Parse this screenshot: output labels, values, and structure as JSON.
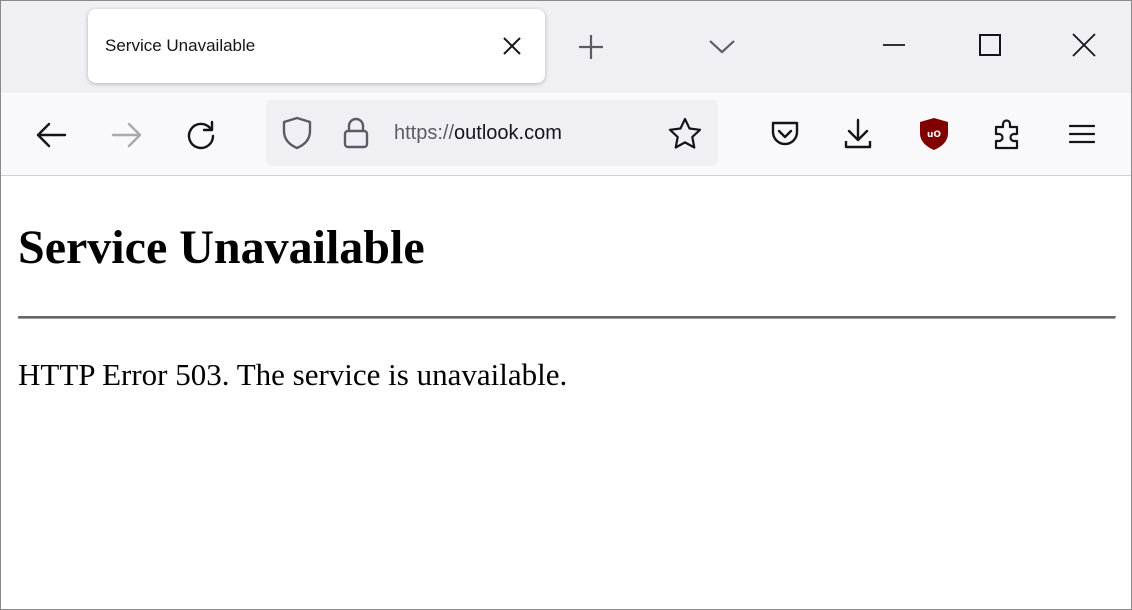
{
  "browser": {
    "tab": {
      "title": "Service Unavailable"
    },
    "urlbar": {
      "scheme": "https://",
      "host": "outlook.com"
    },
    "icons": {
      "tab_close": "close-icon",
      "new_tab": "plus-icon",
      "tab_list": "chevron-down-icon",
      "minimize": "minimize-icon",
      "maximize": "maximize-icon",
      "close_window": "close-icon",
      "back": "arrow-left-icon",
      "forward": "arrow-right-icon",
      "reload": "reload-icon",
      "tracking_protection": "shield-icon",
      "site_security": "lock-icon",
      "bookmark": "star-icon",
      "pocket": "pocket-icon",
      "downloads": "download-icon",
      "ublock": "ublock-origin-icon",
      "extensions": "puzzle-icon",
      "menu": "hamburger-menu-icon"
    },
    "colors": {
      "tabstrip_bg": "#f0f0f4",
      "navbar_bg": "#f9f9fb",
      "urlbar_bg": "#f0f0f4",
      "icon": "#5b5b66",
      "ublock_red": "#800000"
    }
  },
  "page": {
    "heading": "Service Unavailable",
    "message": "HTTP Error 503. The service is unavailable."
  }
}
